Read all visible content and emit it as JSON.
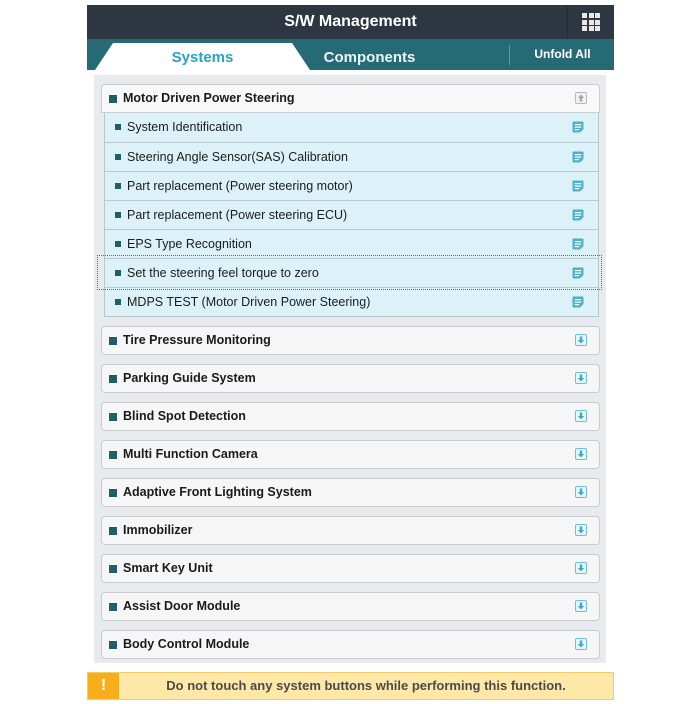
{
  "header": {
    "title": "S/W Management",
    "menu_icon": "grid-menu-icon"
  },
  "tabs": {
    "systems": "Systems",
    "components": "Components",
    "active": "Systems",
    "unfold_all": "Unfold All"
  },
  "expanded_group": {
    "label": "Motor Driven Power Steering",
    "toggle_icon": "collapse-up-icon",
    "items": [
      {
        "label": "System Identification",
        "icon": "document-icon"
      },
      {
        "label": "Steering Angle Sensor(SAS) Calibration",
        "icon": "document-icon"
      },
      {
        "label": "Part replacement (Power steering motor)",
        "icon": "document-icon"
      },
      {
        "label": "Part replacement (Power steering ECU)",
        "icon": "document-icon"
      },
      {
        "label": "EPS Type Recognition",
        "icon": "document-icon"
      },
      {
        "label": "Set the steering feel torque to zero",
        "icon": "document-icon",
        "highlighted": true
      },
      {
        "label": "MDPS TEST (Motor Driven Power Steering)",
        "icon": "document-icon"
      }
    ]
  },
  "groups": [
    {
      "label": "Tire Pressure Monitoring",
      "toggle_icon": "expand-down-icon"
    },
    {
      "label": "Parking Guide System",
      "toggle_icon": "expand-down-icon"
    },
    {
      "label": "Blind Spot Detection",
      "toggle_icon": "expand-down-icon"
    },
    {
      "label": "Multi Function Camera",
      "toggle_icon": "expand-down-icon"
    },
    {
      "label": "Adaptive Front Lighting System",
      "toggle_icon": "expand-down-icon"
    },
    {
      "label": "Immobilizer",
      "toggle_icon": "expand-down-icon"
    },
    {
      "label": "Smart Key Unit",
      "toggle_icon": "expand-down-icon"
    },
    {
      "label": "Assist Door Module",
      "toggle_icon": "expand-down-icon"
    },
    {
      "label": "Body Control Module",
      "toggle_icon": "expand-down-icon"
    }
  ],
  "warning": {
    "icon": "!",
    "message": "Do not touch any system buttons while performing this function."
  },
  "colors": {
    "header_bg": "#2e3642",
    "tabbar_bg": "#256a75",
    "active_tab_text": "#2aa4bd",
    "inactive_tab_bg": "#44afc4",
    "sub_item_bg": "#dcf2f8",
    "bullet": "#1f5f6a",
    "highlight_border": "#e23434",
    "warning_bg": "#fee8a8",
    "warning_icon_bg": "#f7ae1b"
  }
}
